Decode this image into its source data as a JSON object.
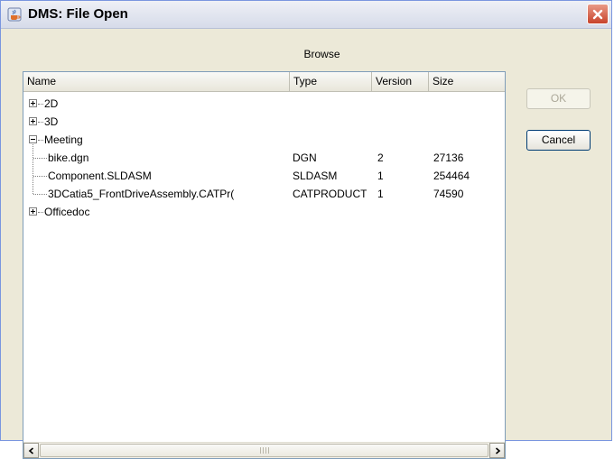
{
  "window": {
    "title": "DMS: File Open"
  },
  "browse_label": "Browse",
  "columns": [
    {
      "label": "Name"
    },
    {
      "label": "Type"
    },
    {
      "label": "Version"
    },
    {
      "label": "Size"
    }
  ],
  "tree": [
    {
      "name": "2D",
      "type": "",
      "version": "",
      "size": "",
      "kind": "folder",
      "expanded": false,
      "level": 0
    },
    {
      "name": "3D",
      "type": "",
      "version": "",
      "size": "",
      "kind": "folder",
      "expanded": false,
      "level": 0
    },
    {
      "name": "Meeting",
      "type": "",
      "version": "",
      "size": "",
      "kind": "folder",
      "expanded": true,
      "level": 0
    },
    {
      "name": "bike.dgn",
      "type": "DGN",
      "version": "2",
      "size": "27136",
      "kind": "file",
      "level": 1
    },
    {
      "name": "Component.SLDASM",
      "type": "SLDASM",
      "version": "1",
      "size": "254464",
      "kind": "file",
      "level": 1
    },
    {
      "name": "3DCatia5_FrontDriveAssembly.CATPr(",
      "type": "CATPRODUCT",
      "version": "1",
      "size": "74590",
      "kind": "file",
      "level": 1
    },
    {
      "name": "Officedoc",
      "type": "",
      "version": "",
      "size": "",
      "kind": "folder",
      "expanded": false,
      "level": 0
    }
  ],
  "buttons": {
    "ok_label": "OK",
    "cancel_label": "Cancel"
  },
  "scrollbar": {
    "grip_label": "III"
  },
  "icons": {
    "title": "java-cup-icon",
    "close": "close-icon",
    "scroll_left": "arrow-left-icon",
    "scroll_right": "arrow-right-icon"
  }
}
